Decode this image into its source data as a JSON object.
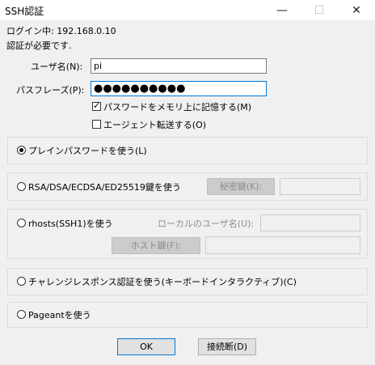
{
  "window": {
    "title": "SSH認証",
    "minimize_glyph": "—",
    "maximize_glyph": "☐",
    "close_glyph": "✕"
  },
  "login_line": "ログイン中: 192.168.0.10",
  "auth_required": "認証が必要です.",
  "username": {
    "label": "ユーザ名(N):",
    "value": "pi"
  },
  "passphrase": {
    "label": "パスフレーズ(P):",
    "dots": "●●●●●●●●●●"
  },
  "remember_password": {
    "label": "パスワードをメモリ上に記憶する(M)",
    "checked": true
  },
  "agent_forwarding": {
    "label": "エージェント転送する(O)",
    "checked": false
  },
  "methods": {
    "plain": {
      "label": "プレインパスワードを使う(L)",
      "selected": true
    },
    "rsa": {
      "label": "RSA/DSA/ECDSA/ED25519鍵を使う",
      "selected": false,
      "key_button": "秘密鍵(K):",
      "key_value": ""
    },
    "rhosts": {
      "label": "rhosts(SSH1)を使う",
      "selected": false,
      "local_user_label": "ローカルのユーザ名(U):",
      "local_user_value": "",
      "host_key_button": "ホスト鍵(F):",
      "host_key_value": ""
    },
    "challenge": {
      "label": "チャレンジレスポンス認証を使う(キーボードインタラクティブ)(C)",
      "selected": false
    },
    "pageant": {
      "label": "Pageantを使う",
      "selected": false
    }
  },
  "buttons": {
    "ok": "OK",
    "disconnect": "接続断(D)"
  }
}
